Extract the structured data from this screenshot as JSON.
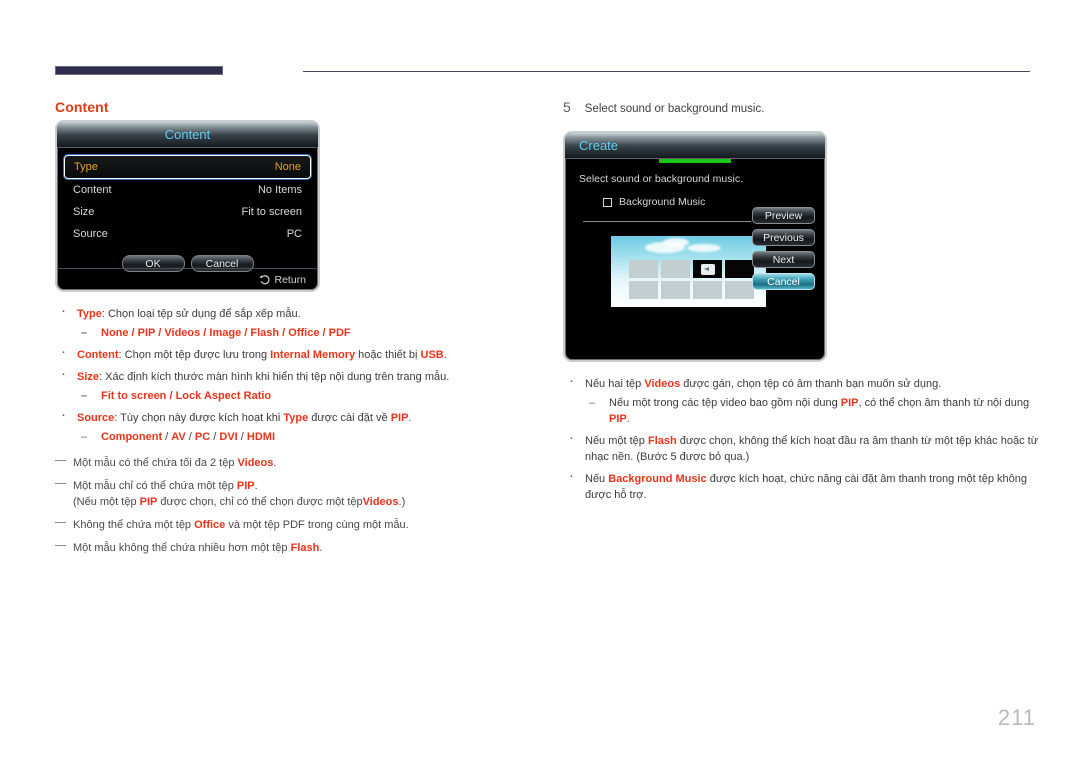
{
  "page": {
    "number": "211",
    "section_heading": "Content"
  },
  "content_dialog": {
    "title": "Content",
    "rows": [
      {
        "label": "Type",
        "value": "None",
        "selected": true
      },
      {
        "label": "Content",
        "value": "No Items",
        "selected": false
      },
      {
        "label": "Size",
        "value": "Fit to screen",
        "selected": false
      },
      {
        "label": "Source",
        "value": "PC",
        "selected": false
      }
    ],
    "ok_label": "OK",
    "cancel_label": "Cancel",
    "return_label": "Return"
  },
  "step5": {
    "number": "5",
    "text": "Select sound or background music."
  },
  "create_dialog": {
    "title": "Create",
    "caption": "Select sound or background music.",
    "checkbox_label": "Background Music",
    "checkbox_checked": false,
    "buttons": [
      {
        "label": "Preview",
        "active": false
      },
      {
        "label": "Previous",
        "active": false
      },
      {
        "label": "Next",
        "active": false
      },
      {
        "label": "Cancel",
        "active": true
      }
    ]
  },
  "left_column": {
    "bullets": [
      {
        "lead": "Type",
        "text": ": Chọn loại tệp sử dụng để sắp xếp mẫu.",
        "sub": "None / PIP / Videos / Image / Flash / Office / PDF"
      },
      {
        "lead": "Content",
        "text_parts": [
          {
            "t": ": Chọn một tệp được lưu trong ",
            "style": "plain"
          },
          {
            "t": "Internal Memory",
            "style": "red"
          },
          {
            "t": " hoặc thiết bị ",
            "style": "plain"
          },
          {
            "t": "USB",
            "style": "red"
          },
          {
            "t": ".",
            "style": "plain"
          }
        ]
      },
      {
        "lead": "Size",
        "text": ": Xác định kích thước màn hình khi hiển thị tệp nội dung trên trang mẫu.",
        "sub": "Fit to screen / Lock Aspect Ratio"
      },
      {
        "lead": "Source",
        "text_parts": [
          {
            "t": ": Tùy chọn này được kích hoạt khi ",
            "style": "plain"
          },
          {
            "t": "Type",
            "style": "red"
          },
          {
            "t": " được cài đặt về ",
            "style": "plain"
          },
          {
            "t": "PIP",
            "style": "red"
          },
          {
            "t": ".",
            "style": "plain"
          }
        ],
        "sub": "Component / AV / PC / DVI / HDMI"
      }
    ],
    "notes": [
      [
        {
          "t": "Một mẫu có thể chứa tối đa 2 tệp ",
          "style": "plain"
        },
        {
          "t": "Videos",
          "style": "red"
        },
        {
          "t": ".",
          "style": "plain"
        }
      ],
      [
        {
          "t": "Một mẫu chỉ có thể chứa một tệp ",
          "style": "plain"
        },
        {
          "t": "PIP",
          "style": "red"
        },
        {
          "t": ".",
          "style": "plain"
        },
        {
          "t": "\n",
          "style": "break"
        },
        {
          "t": "(Nếu một tệp ",
          "style": "plain"
        },
        {
          "t": "PIP",
          "style": "red"
        },
        {
          "t": " được chọn, chỉ có thể chọn được một tệp",
          "style": "plain"
        },
        {
          "t": "Videos",
          "style": "red"
        },
        {
          "t": ".)",
          "style": "plain"
        }
      ],
      [
        {
          "t": "Không thể chứa một tệp ",
          "style": "plain"
        },
        {
          "t": "Office",
          "style": "red"
        },
        {
          "t": " và một tệp PDF trong cùng một mẫu.",
          "style": "plain"
        }
      ],
      [
        {
          "t": "Một mẫu không thể chứa nhiều hơn một tệp ",
          "style": "plain"
        },
        {
          "t": "Flash",
          "style": "red"
        },
        {
          "t": ".",
          "style": "plain"
        }
      ]
    ]
  },
  "right_column": {
    "bullets": [
      {
        "parts": [
          {
            "t": "Nếu hai tệp ",
            "style": "plain"
          },
          {
            "t": "Videos",
            "style": "red"
          },
          {
            "t": " được gán, chọn tệp có âm thanh bạn muốn sử dụng.",
            "style": "plain"
          }
        ],
        "sub_parts": [
          {
            "t": "Nếu một trong các tệp video bao gồm nội dung ",
            "style": "plain"
          },
          {
            "t": "PIP",
            "style": "red"
          },
          {
            "t": ", có thể chọn âm thanh từ nội dung ",
            "style": "plain"
          },
          {
            "t": "PIP",
            "style": "red"
          },
          {
            "t": ".",
            "style": "plain"
          }
        ]
      },
      {
        "parts": [
          {
            "t": "Nếu một tệp ",
            "style": "plain"
          },
          {
            "t": "Flash",
            "style": "red"
          },
          {
            "t": " được chọn, không thể kích hoạt đầu ra âm thanh từ một tệp khác hoặc từ nhạc nền. (Bước 5 được bỏ qua.)",
            "style": "plain"
          }
        ]
      },
      {
        "parts": [
          {
            "t": "Nếu ",
            "style": "plain"
          },
          {
            "t": "Background Music",
            "style": "red"
          },
          {
            "t": " được kích hoạt, chức năng cài đặt âm thanh trong một tệp không được hỗ trợ.",
            "style": "plain"
          }
        ]
      }
    ]
  },
  "colors": {
    "accent_red": "#e8331c",
    "heading_red": "#e03a15",
    "rule_navy": "#2e2d4d",
    "osd_cyan": "#63cdf0",
    "osd_orange": "#e4a324",
    "progress_green": "#18c718"
  }
}
